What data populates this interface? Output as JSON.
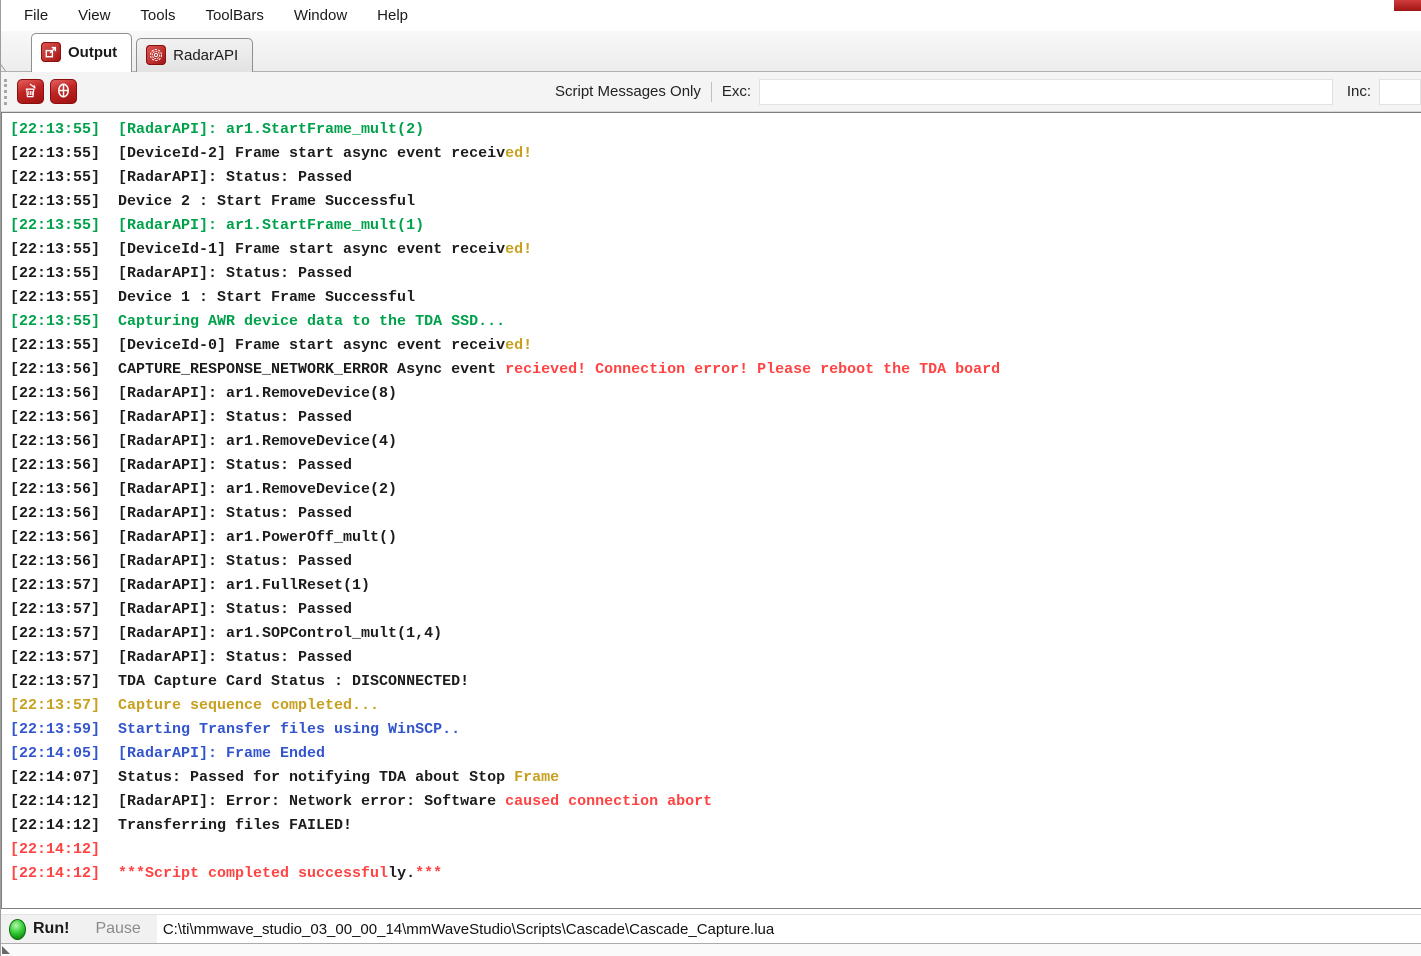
{
  "menu": {
    "items": [
      "File",
      "View",
      "Tools",
      "ToolBars",
      "Window",
      "Help"
    ]
  },
  "tabs": [
    {
      "label": "Output",
      "icon": "export-icon",
      "active": true
    },
    {
      "label": "RadarAPI",
      "icon": "radar-icon",
      "active": false
    }
  ],
  "toolbar": {
    "filter_label": "Script Messages Only",
    "exc_label": "Exc:",
    "inc_label": "Inc:",
    "exc_value": "",
    "inc_value": "",
    "clear_icon": "trash-icon",
    "pause_icon": "theta-icon"
  },
  "colors": {
    "green": "#00a14b",
    "gold": "#c6a01e",
    "red": "#ff4343",
    "blue": "#3355cc",
    "black": "#1c1c1c"
  },
  "log": {
    "lines": [
      {
        "ts": "[22:13:55]",
        "tsc": "green",
        "segs": [
          {
            "t": "[RadarAPI]: ar1.StartFrame_mult(2)",
            "c": "green"
          }
        ]
      },
      {
        "ts": "[22:13:55]",
        "tsc": "black",
        "segs": [
          {
            "t": "[DeviceId-2] Frame start async event receiv",
            "c": "black"
          },
          {
            "t": "ed!",
            "c": "gold"
          }
        ]
      },
      {
        "ts": "[22:13:55]",
        "tsc": "black",
        "segs": [
          {
            "t": "[RadarAPI]: Status: Passed",
            "c": "black"
          }
        ]
      },
      {
        "ts": "[22:13:55]",
        "tsc": "black",
        "segs": [
          {
            "t": "Device 2 : Start Frame Successful",
            "c": "black"
          }
        ]
      },
      {
        "ts": "[22:13:55]",
        "tsc": "green",
        "segs": [
          {
            "t": "[RadarAPI]: ar1.StartFrame_mult(1)",
            "c": "green"
          }
        ]
      },
      {
        "ts": "[22:13:55]",
        "tsc": "black",
        "segs": [
          {
            "t": "[DeviceId-1] Frame start async event receiv",
            "c": "black"
          },
          {
            "t": "ed!",
            "c": "gold"
          }
        ]
      },
      {
        "ts": "[22:13:55]",
        "tsc": "black",
        "segs": [
          {
            "t": "[RadarAPI]: Status: Passed",
            "c": "black"
          }
        ]
      },
      {
        "ts": "[22:13:55]",
        "tsc": "black",
        "segs": [
          {
            "t": "Device 1 : Start Frame Successful",
            "c": "black"
          }
        ]
      },
      {
        "ts": "[22:13:55]",
        "tsc": "green",
        "segs": [
          {
            "t": "Capturing AWR device data to the TDA SSD...",
            "c": "green"
          }
        ]
      },
      {
        "ts": "[22:13:55]",
        "tsc": "black",
        "segs": [
          {
            "t": "[DeviceId-0] Frame start async event receiv",
            "c": "black"
          },
          {
            "t": "ed!",
            "c": "gold"
          }
        ]
      },
      {
        "ts": "[22:13:56]",
        "tsc": "black",
        "segs": [
          {
            "t": "CAPTURE_RESPONSE_NETWORK_ERROR Async event ",
            "c": "black"
          },
          {
            "t": "recieved! Connection error! Please reboot the TDA board",
            "c": "red"
          }
        ]
      },
      {
        "ts": "[22:13:56]",
        "tsc": "black",
        "segs": [
          {
            "t": "[RadarAPI]: ar1.RemoveDevice(8)",
            "c": "black"
          }
        ]
      },
      {
        "ts": "[22:13:56]",
        "tsc": "black",
        "segs": [
          {
            "t": "[RadarAPI]: Status: Passed",
            "c": "black"
          }
        ]
      },
      {
        "ts": "[22:13:56]",
        "tsc": "black",
        "segs": [
          {
            "t": "[RadarAPI]: ar1.RemoveDevice(4)",
            "c": "black"
          }
        ]
      },
      {
        "ts": "[22:13:56]",
        "tsc": "black",
        "segs": [
          {
            "t": "[RadarAPI]: Status: Passed",
            "c": "black"
          }
        ]
      },
      {
        "ts": "[22:13:56]",
        "tsc": "black",
        "segs": [
          {
            "t": "[RadarAPI]: ar1.RemoveDevice(2)",
            "c": "black"
          }
        ]
      },
      {
        "ts": "[22:13:56]",
        "tsc": "black",
        "segs": [
          {
            "t": "[RadarAPI]: Status: Passed",
            "c": "black"
          }
        ]
      },
      {
        "ts": "[22:13:56]",
        "tsc": "black",
        "segs": [
          {
            "t": "[RadarAPI]: ar1.PowerOff_mult()",
            "c": "black"
          }
        ]
      },
      {
        "ts": "[22:13:56]",
        "tsc": "black",
        "segs": [
          {
            "t": "[RadarAPI]: Status: Passed",
            "c": "black"
          }
        ]
      },
      {
        "ts": "[22:13:57]",
        "tsc": "black",
        "segs": [
          {
            "t": "[RadarAPI]: ar1.FullReset(1)",
            "c": "black"
          }
        ]
      },
      {
        "ts": "[22:13:57]",
        "tsc": "black",
        "segs": [
          {
            "t": "[RadarAPI]: Status: Passed",
            "c": "black"
          }
        ]
      },
      {
        "ts": "[22:13:57]",
        "tsc": "black",
        "segs": [
          {
            "t": "[RadarAPI]: ar1.SOPControl_mult(1,4)",
            "c": "black"
          }
        ]
      },
      {
        "ts": "[22:13:57]",
        "tsc": "black",
        "segs": [
          {
            "t": "[RadarAPI]: Status: Passed",
            "c": "black"
          }
        ]
      },
      {
        "ts": "[22:13:57]",
        "tsc": "black",
        "segs": [
          {
            "t": "TDA Capture Card Status : DISCONNECTED!",
            "c": "black"
          }
        ]
      },
      {
        "ts": "[22:13:57]",
        "tsc": "gold",
        "segs": [
          {
            "t": "Capture sequence completed...",
            "c": "gold"
          }
        ]
      },
      {
        "ts": "[22:13:59]",
        "tsc": "blue",
        "segs": [
          {
            "t": "Starting Transfer files using WinSCP..",
            "c": "blue"
          }
        ]
      },
      {
        "ts": "[22:14:05]",
        "tsc": "blue",
        "segs": [
          {
            "t": "[RadarAPI]: Frame Ended",
            "c": "blue"
          }
        ]
      },
      {
        "ts": "[22:14:07]",
        "tsc": "black",
        "segs": [
          {
            "t": "Status: Passed for notifying TDA about Stop ",
            "c": "black"
          },
          {
            "t": "Frame",
            "c": "gold"
          }
        ]
      },
      {
        "ts": "[22:14:12]",
        "tsc": "black",
        "segs": [
          {
            "t": "[RadarAPI]: Error: Network error: Software ",
            "c": "black"
          },
          {
            "t": "caused connection abort",
            "c": "red"
          }
        ]
      },
      {
        "ts": "[22:14:12]",
        "tsc": "black",
        "segs": [
          {
            "t": "Transferring files FAILED!",
            "c": "black"
          }
        ]
      },
      {
        "ts": "[22:14:12]",
        "tsc": "red",
        "segs": []
      },
      {
        "ts": "[22:14:12]",
        "tsc": "red",
        "segs": [
          {
            "t": "***Script completed successful",
            "c": "red"
          },
          {
            "t": "ly.",
            "c": "black"
          },
          {
            "t": "***",
            "c": "red"
          }
        ]
      }
    ]
  },
  "bottombar": {
    "run_label": "Run!",
    "pause_label": "Pause",
    "script_path": "C:\\ti\\mmwave_studio_03_00_00_14\\mmWaveStudio\\Scripts\\Cascade\\Cascade_Capture.lua"
  }
}
